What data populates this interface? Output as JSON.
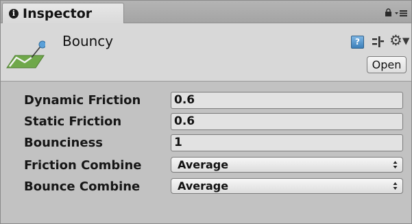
{
  "tab": {
    "title": "Inspector",
    "info_icon": "info-icon"
  },
  "window_icons": {
    "lock": "lock-icon",
    "menu": "tab-menu-icon"
  },
  "asset": {
    "name": "Bouncy",
    "icon": "physic-material-icon",
    "open_label": "Open",
    "help_glyph": "?",
    "header_icons": [
      "help-icon",
      "presets-icon",
      "gear-icon"
    ]
  },
  "properties": {
    "dynamic_friction": {
      "label": "Dynamic Friction",
      "value": "0.6"
    },
    "static_friction": {
      "label": "Static Friction",
      "value": "0.6"
    },
    "bounciness": {
      "label": "Bounciness",
      "value": "1"
    },
    "friction_combine": {
      "label": "Friction Combine",
      "value": "Average"
    },
    "bounce_combine": {
      "label": "Bounce Combine",
      "value": "Average"
    }
  },
  "colors": {
    "panel_bg": "#c2c2c2",
    "header_bg": "#d8d8d8",
    "field_bg": "#e2e2e2",
    "help_blue": "#3b7fba",
    "icon_green": "#6fa84a"
  }
}
